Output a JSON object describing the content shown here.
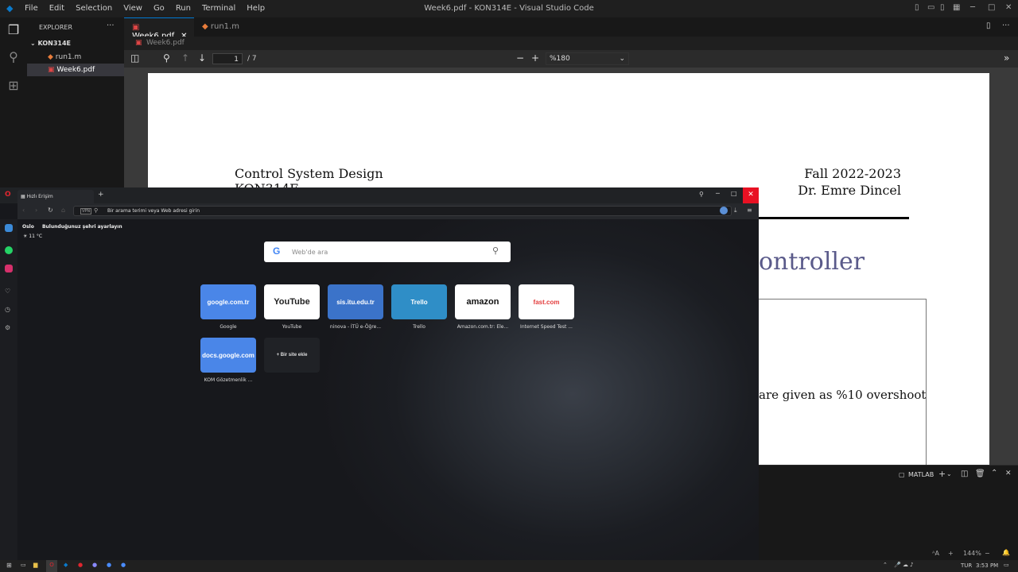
{
  "vscode": {
    "menu": [
      "File",
      "Edit",
      "Selection",
      "View",
      "Go",
      "Run",
      "Terminal",
      "Help"
    ],
    "window_title": "Week6.pdf - KON314E - Visual Studio Code",
    "explorer_title": "EXPLORER",
    "folder": "KON314E",
    "files": [
      "run1.m",
      "Week6.pdf"
    ],
    "tabs": [
      "Week6.pdf",
      "run1.m"
    ],
    "breadcrumb": "Week6.pdf",
    "pdf": {
      "page": "1",
      "page_total": "/ 7",
      "zoom": "%180"
    },
    "panel_label": "MATLAB",
    "status_right": [
      "ᴬA",
      "+",
      "144%",
      "−"
    ]
  },
  "pdf_page": {
    "left_title": "Control System Design",
    "left_sub": "KON314E",
    "right_title": "Fall 2022-2023",
    "right_sub": "Dr. Emre Dincel",
    "heading_fragment": "ontroller",
    "body_fragment": "are given as %10 overshoot"
  },
  "opera": {
    "tab_title": "Hızlı Erişim",
    "address_badge": "VPN",
    "address_placeholder": "Bir arama terimi veya Web adresi girin",
    "weather_city": "Oslo",
    "weather_prompt": "Bulunduğunuz şehri ayarlayın",
    "weather_temp": "11 °C",
    "search_placeholder": "Web'de ara",
    "speed_dials": [
      {
        "logo": "google.com.tr",
        "label": "Google",
        "bg": "#4a86e8",
        "fg": "#ffffff"
      },
      {
        "logo": "YouTube",
        "label": "YouTube",
        "bg": "#ffffff",
        "fg": "#222222"
      },
      {
        "logo": "sis.itu.edu.tr",
        "label": "ninova - İTÜ e-Öğre...",
        "bg": "#3b73c9",
        "fg": "#ffffff"
      },
      {
        "logo": "Trello",
        "label": "Trello",
        "bg": "#2f8ec7",
        "fg": "#ffffff"
      },
      {
        "logo": "amazon",
        "label": "Amazon.com.tr: Ele...",
        "bg": "#ffffff",
        "fg": "#111111"
      },
      {
        "logo": "fast.com",
        "label": "Internet Speed Test ...",
        "bg": "#ffffff",
        "fg": "#e33b3b"
      },
      {
        "logo": "docs.google.com",
        "label": "KOM Gözetmenlik ...",
        "bg": "#4a86e8",
        "fg": "#ffffff"
      },
      {
        "logo": "+ Bir site ekle",
        "label": "",
        "bg": "#202226",
        "fg": "#dddddd"
      }
    ]
  },
  "taskbar": {
    "lang": "TUR",
    "time": "3:53 PM"
  }
}
